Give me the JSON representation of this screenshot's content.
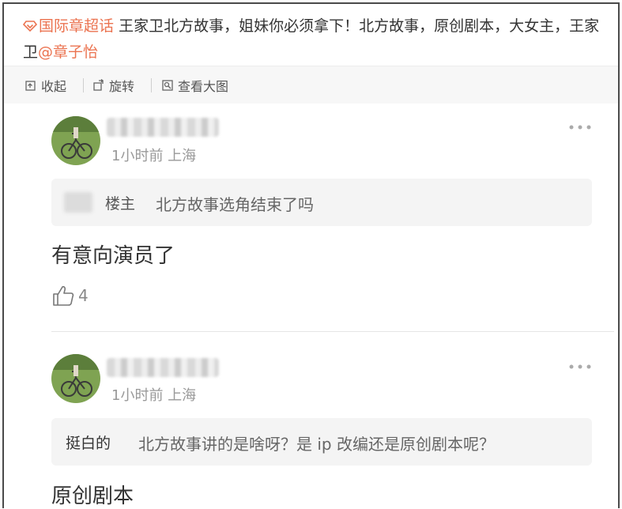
{
  "post": {
    "topic_label": "国际章超话",
    "text_main": " 王家卫北方故事，姐妹你必须拿下！北方故事，原创剧本，大女主，王家卫",
    "mention": "@章子怡"
  },
  "toolbar": {
    "collapse_label": "收起",
    "rotate_label": "旋转",
    "view_large_label": "查看大图"
  },
  "comments": [
    {
      "time_location": "1小时前 上海",
      "quote_tag": "楼主",
      "quote_text": "北方故事选角结束了吗",
      "reply": "有意向演员了",
      "likes": "4"
    },
    {
      "time_location": "1小时前 上海",
      "quote_user": "挺白的",
      "quote_text": "北方故事讲的是啥呀？是 ip 改编还是原创剧本呢？",
      "reply": "原创剧本"
    }
  ],
  "colors": {
    "accent": "#eb7350",
    "toolbar_bg": "#f7f7f7",
    "quote_bg": "#f4f4f4"
  }
}
